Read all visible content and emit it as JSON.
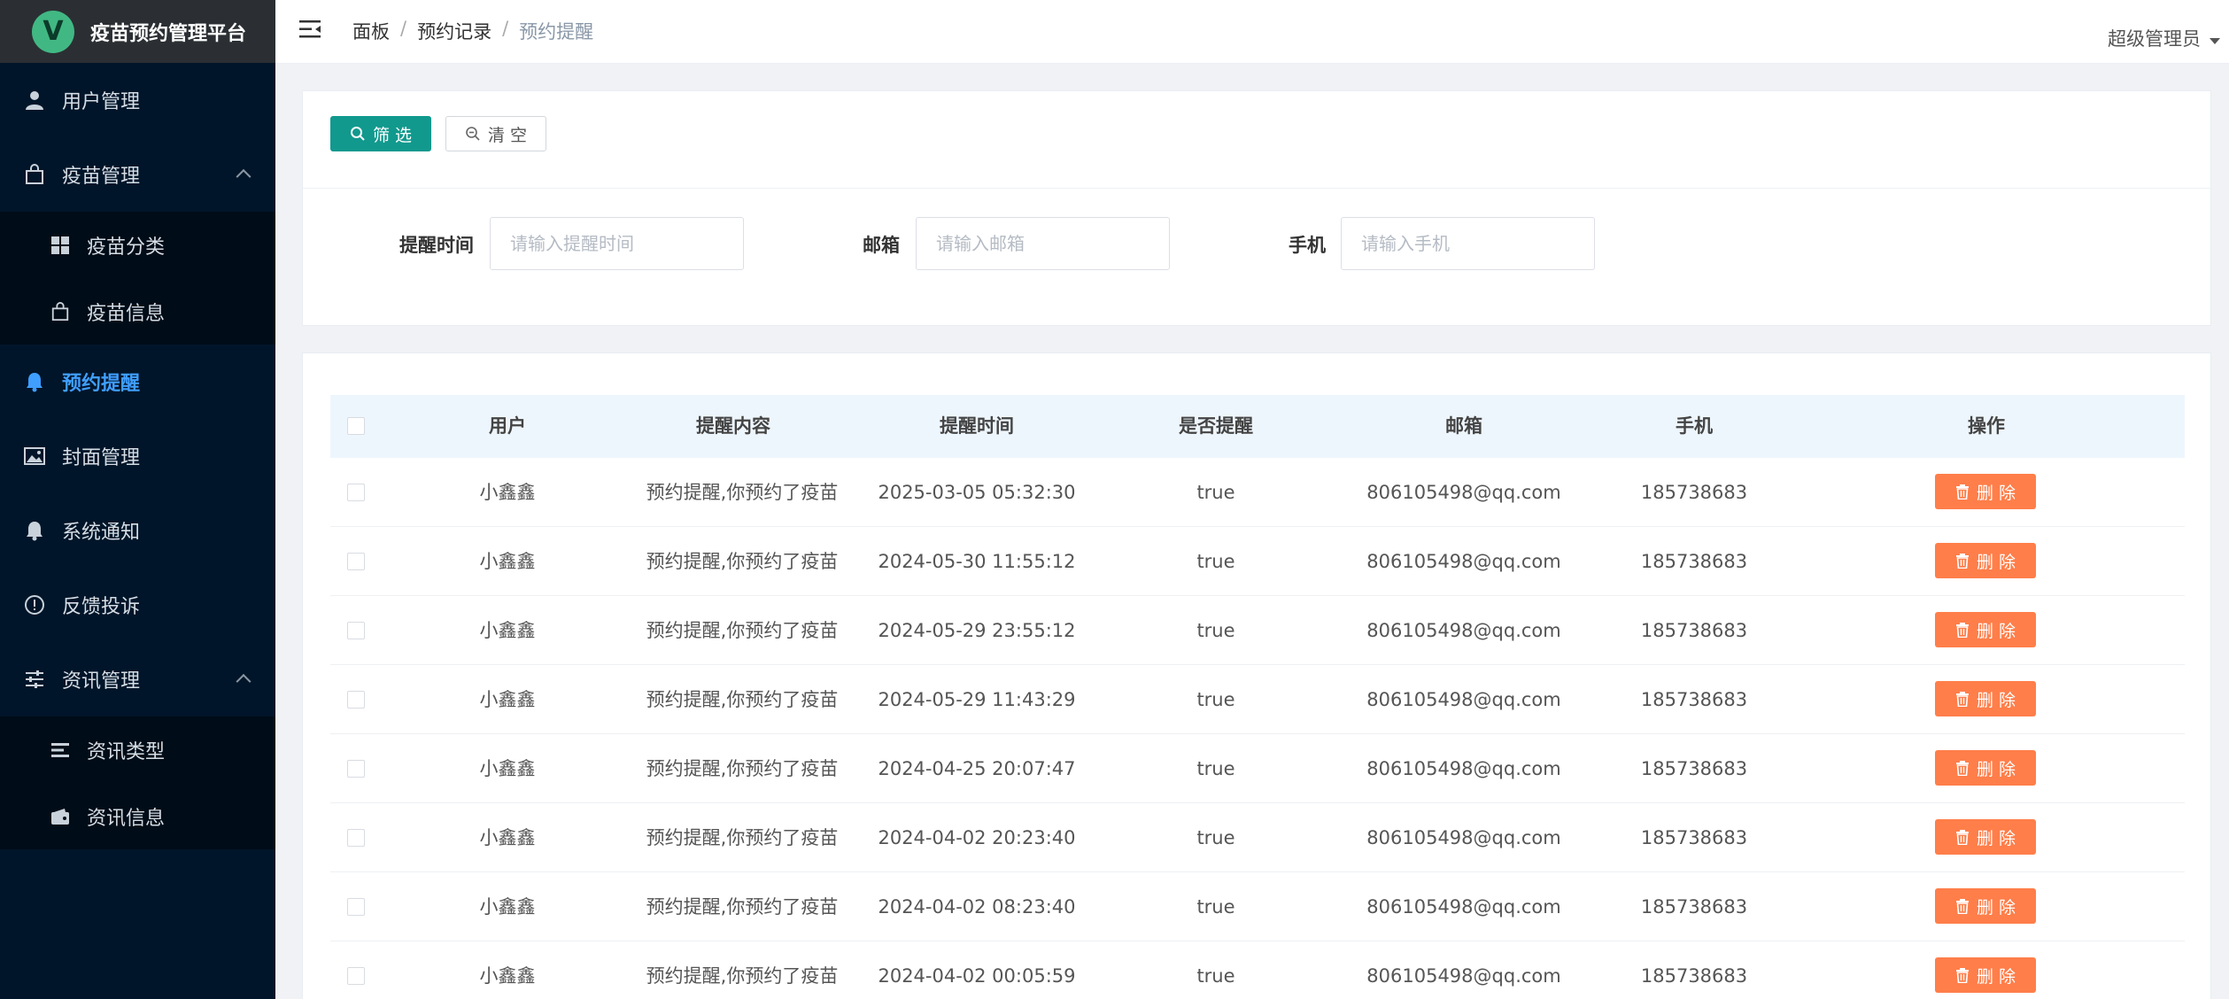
{
  "app": {
    "logo_letter": "V",
    "title": "疫苗预约管理平台"
  },
  "sidebar": {
    "items": [
      {
        "label": "用户管理",
        "icon": "user-icon"
      },
      {
        "label": "疫苗管理",
        "icon": "bag-icon",
        "expanded": true,
        "children": [
          {
            "label": "疫苗分类",
            "icon": "grid-icon"
          },
          {
            "label": "疫苗信息",
            "icon": "bag-icon"
          }
        ]
      },
      {
        "label": "预约提醒",
        "icon": "bell-icon",
        "active": true
      },
      {
        "label": "封面管理",
        "icon": "picture-icon"
      },
      {
        "label": "系统通知",
        "icon": "bell-icon"
      },
      {
        "label": "反馈投诉",
        "icon": "warning-circle-icon"
      },
      {
        "label": "资讯管理",
        "icon": "sliders-icon",
        "expanded": true,
        "children": [
          {
            "label": "资讯类型",
            "icon": "list-icon"
          },
          {
            "label": "资讯信息",
            "icon": "wallet-icon"
          }
        ]
      }
    ]
  },
  "header": {
    "breadcrumb": [
      "面板",
      "预约记录",
      "预约提醒"
    ],
    "user": "超级管理员"
  },
  "filter": {
    "filter_button": "筛 选",
    "clear_button": "清 空",
    "fields": [
      {
        "label": "提醒时间",
        "placeholder": "请输入提醒时间"
      },
      {
        "label": "邮箱",
        "placeholder": "请输入邮箱"
      },
      {
        "label": "手机",
        "placeholder": "请输入手机"
      }
    ]
  },
  "table": {
    "columns": [
      "用户",
      "提醒内容",
      "提醒时间",
      "是否提醒",
      "邮箱",
      "手机",
      "操作"
    ],
    "delete_label": "删 除",
    "rows": [
      {
        "user": "小鑫鑫",
        "content": "预约提醒,你预约了疫苗",
        "time": "2025-03-05 05:32:30",
        "reminded": "true",
        "email": "806105498@qq.com",
        "phone": "185738683"
      },
      {
        "user": "小鑫鑫",
        "content": "预约提醒,你预约了疫苗",
        "time": "2024-05-30 11:55:12",
        "reminded": "true",
        "email": "806105498@qq.com",
        "phone": "185738683"
      },
      {
        "user": "小鑫鑫",
        "content": "预约提醒,你预约了疫苗",
        "time": "2024-05-29 23:55:12",
        "reminded": "true",
        "email": "806105498@qq.com",
        "phone": "185738683"
      },
      {
        "user": "小鑫鑫",
        "content": "预约提醒,你预约了疫苗",
        "time": "2024-05-29 11:43:29",
        "reminded": "true",
        "email": "806105498@qq.com",
        "phone": "185738683"
      },
      {
        "user": "小鑫鑫",
        "content": "预约提醒,你预约了疫苗",
        "time": "2024-04-25 20:07:47",
        "reminded": "true",
        "email": "806105498@qq.com",
        "phone": "185738683"
      },
      {
        "user": "小鑫鑫",
        "content": "预约提醒,你预约了疫苗",
        "time": "2024-04-02 20:23:40",
        "reminded": "true",
        "email": "806105498@qq.com",
        "phone": "185738683"
      },
      {
        "user": "小鑫鑫",
        "content": "预约提醒,你预约了疫苗",
        "time": "2024-04-02 08:23:40",
        "reminded": "true",
        "email": "806105498@qq.com",
        "phone": "185738683"
      },
      {
        "user": "小鑫鑫",
        "content": "预约提醒,你预约了疫苗",
        "time": "2024-04-02 00:05:59",
        "reminded": "true",
        "email": "806105498@qq.com",
        "phone": "185738683"
      }
    ]
  },
  "colors": {
    "sidebar_bg": "#001529",
    "active": "#409eff",
    "filter_btn": "#11998e",
    "delete_btn": "#ff7e4a"
  }
}
